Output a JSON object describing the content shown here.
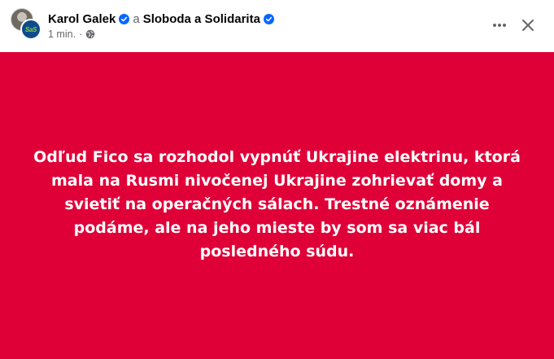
{
  "post": {
    "author": "Karol Galek",
    "conjunction": "a",
    "page": "Sloboda a Solidarita",
    "time": "1 min.",
    "separator": "·",
    "text": "Odľud Fico sa rozhodol vypnúť Ukrajine elektrinu, ktorá mala na Rusmi nivočenej Ukrajine zohrievať domy a svietiť na operačných sálach. Trestné oznámenie podáme, ale na jeho mieste by som sa viac bál posledného súdu.",
    "background_color": "#e00038",
    "text_color": "#ffffff"
  },
  "avatar": {
    "page_logo_text": "SaS"
  },
  "icons": {
    "verified": "verified-badge-icon",
    "audience": "globe-icon",
    "more": "more-horizontal-icon",
    "close": "close-icon"
  },
  "colors": {
    "verified_blue": "#0866ff",
    "secondary_text": "#65676b"
  }
}
